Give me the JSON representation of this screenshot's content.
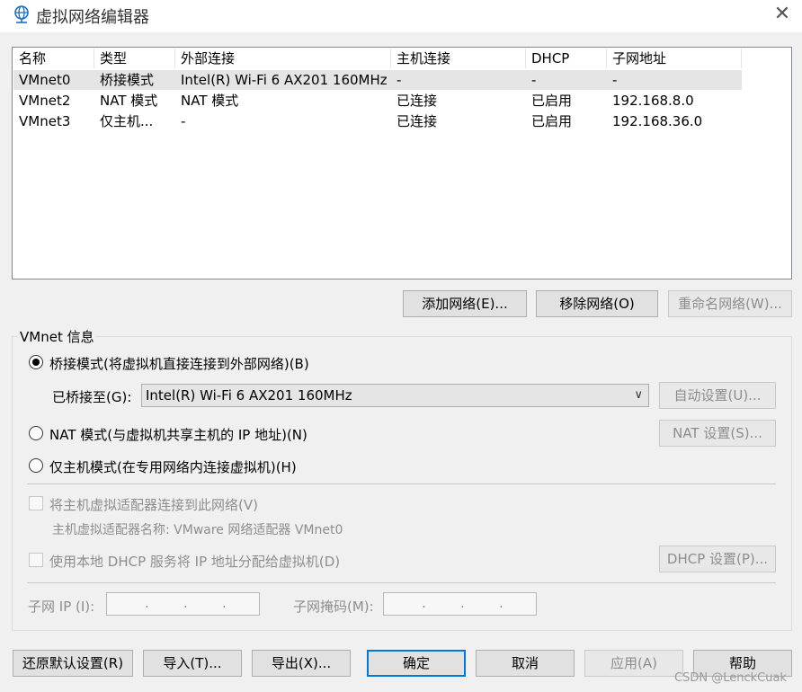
{
  "window": {
    "title": "虚拟网络编辑器",
    "close": "✕"
  },
  "list": {
    "columns": [
      "名称",
      "类型",
      "外部连接",
      "主机连接",
      "DHCP",
      "子网地址"
    ],
    "rows": [
      [
        "VMnet0",
        "桥接模式",
        "Intel(R) Wi-Fi 6 AX201 160MHz",
        "-",
        "-",
        "-"
      ],
      [
        "VMnet2",
        "NAT 模式",
        "NAT 模式",
        "已连接",
        "已启用",
        "192.168.8.0"
      ],
      [
        "VMnet3",
        "仅主机...",
        "-",
        "已连接",
        "已启用",
        "192.168.36.0"
      ]
    ],
    "selected_row": 0
  },
  "list_buttons": {
    "add": "添加网络(E)...",
    "remove": "移除网络(O)",
    "rename": "重命名网络(W)..."
  },
  "vmnet_info": {
    "legend": "VMnet 信息",
    "bridge_radio": "桥接模式(将虚拟机直接连接到外部网络)(B)",
    "bridged_to_label": "已桥接至(G):",
    "bridged_to_value": "Intel(R) Wi-Fi 6 AX201 160MHz",
    "auto_settings": "自动设置(U)...",
    "nat_radio": "NAT 模式(与虚拟机共享主机的 IP 地址)(N)",
    "nat_settings": "NAT 设置(S)...",
    "hostonly_radio": "仅主机模式(在专用网络内连接虚拟机)(H)",
    "connect_adapter": "将主机虚拟适配器连接到此网络(V)",
    "adapter_name": "主机虚拟适配器名称: VMware 网络适配器 VMnet0",
    "use_dhcp": "使用本地 DHCP 服务将 IP 地址分配给虚拟机(D)",
    "dhcp_settings": "DHCP 设置(P)...",
    "subnet_ip_label": "子网 IP (I):",
    "subnet_mask_label": "子网掩码(M):",
    "selected_mode": "bridge"
  },
  "footer": {
    "restore": "还原默认设置(R)",
    "import": "导入(T)...",
    "export": "导出(X)...",
    "ok": "确定",
    "cancel": "取消",
    "apply": "应用(A)",
    "help": "帮助"
  },
  "watermark": "CSDN @LenckCuak",
  "colors": {
    "selected_row": "#e5e5e5",
    "title_icon": "#1f6fbf"
  }
}
